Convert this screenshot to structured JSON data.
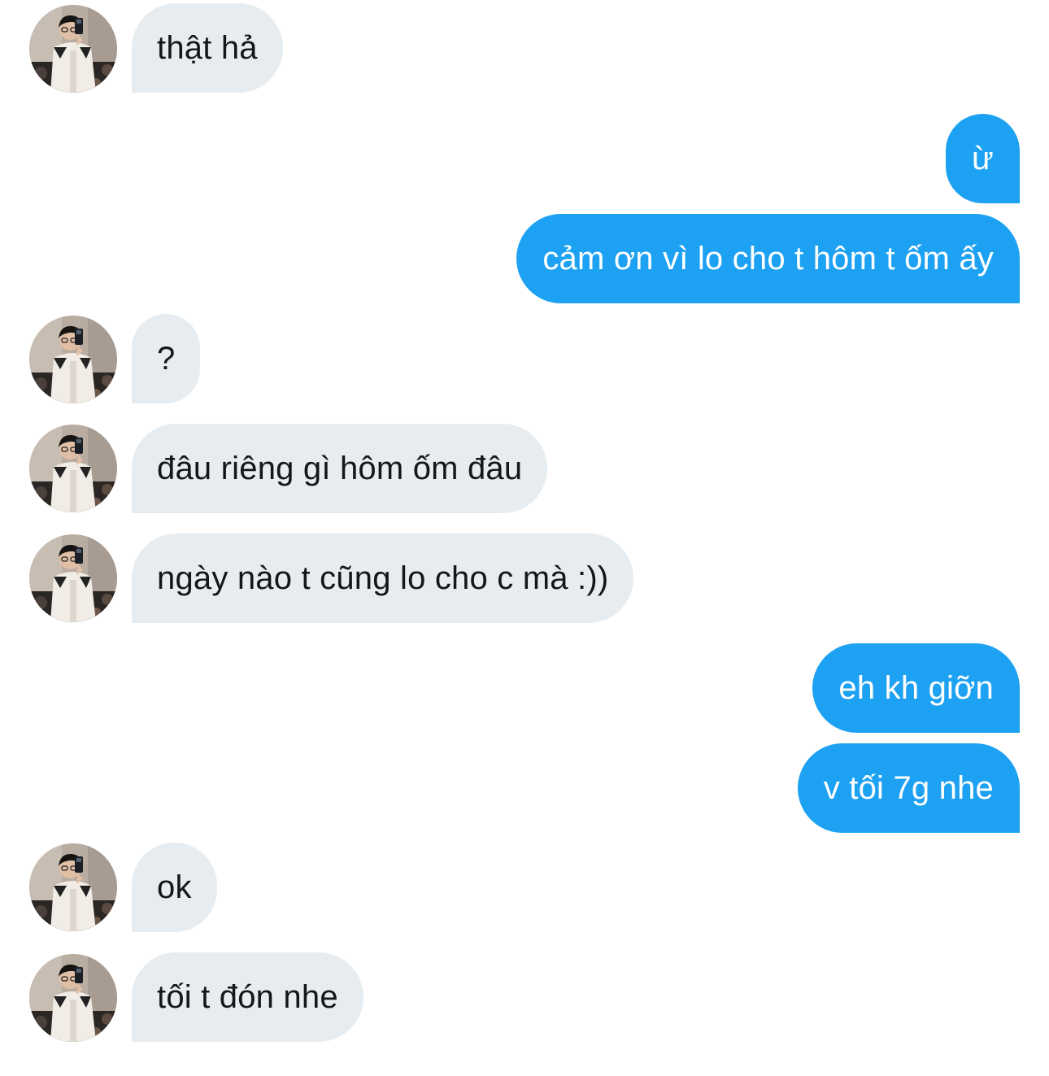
{
  "conversation": {
    "messages": [
      {
        "from": "other",
        "text": "thật hả"
      },
      {
        "from": "me",
        "text": "ừ"
      },
      {
        "from": "me",
        "text": "cảm ơn vì lo cho t hôm t ốm ấy"
      },
      {
        "from": "other",
        "text": "?"
      },
      {
        "from": "other",
        "text": "đâu riêng gì hôm ốm đâu"
      },
      {
        "from": "other",
        "text": "ngày nào t cũng lo cho c mà :))"
      },
      {
        "from": "me",
        "text": "eh kh giỡn"
      },
      {
        "from": "me",
        "text": "v tối 7g nhe"
      },
      {
        "from": "other",
        "text": "ok"
      },
      {
        "from": "other",
        "text": "tối t đón nhe"
      }
    ]
  },
  "colors": {
    "incoming_bubble": "#e6ecf0",
    "incoming_text": "#14171a",
    "outgoing_bubble": "#1da1f2",
    "outgoing_text": "#ffffff"
  },
  "icons": {
    "avatar": "avatar-photo-icon"
  }
}
